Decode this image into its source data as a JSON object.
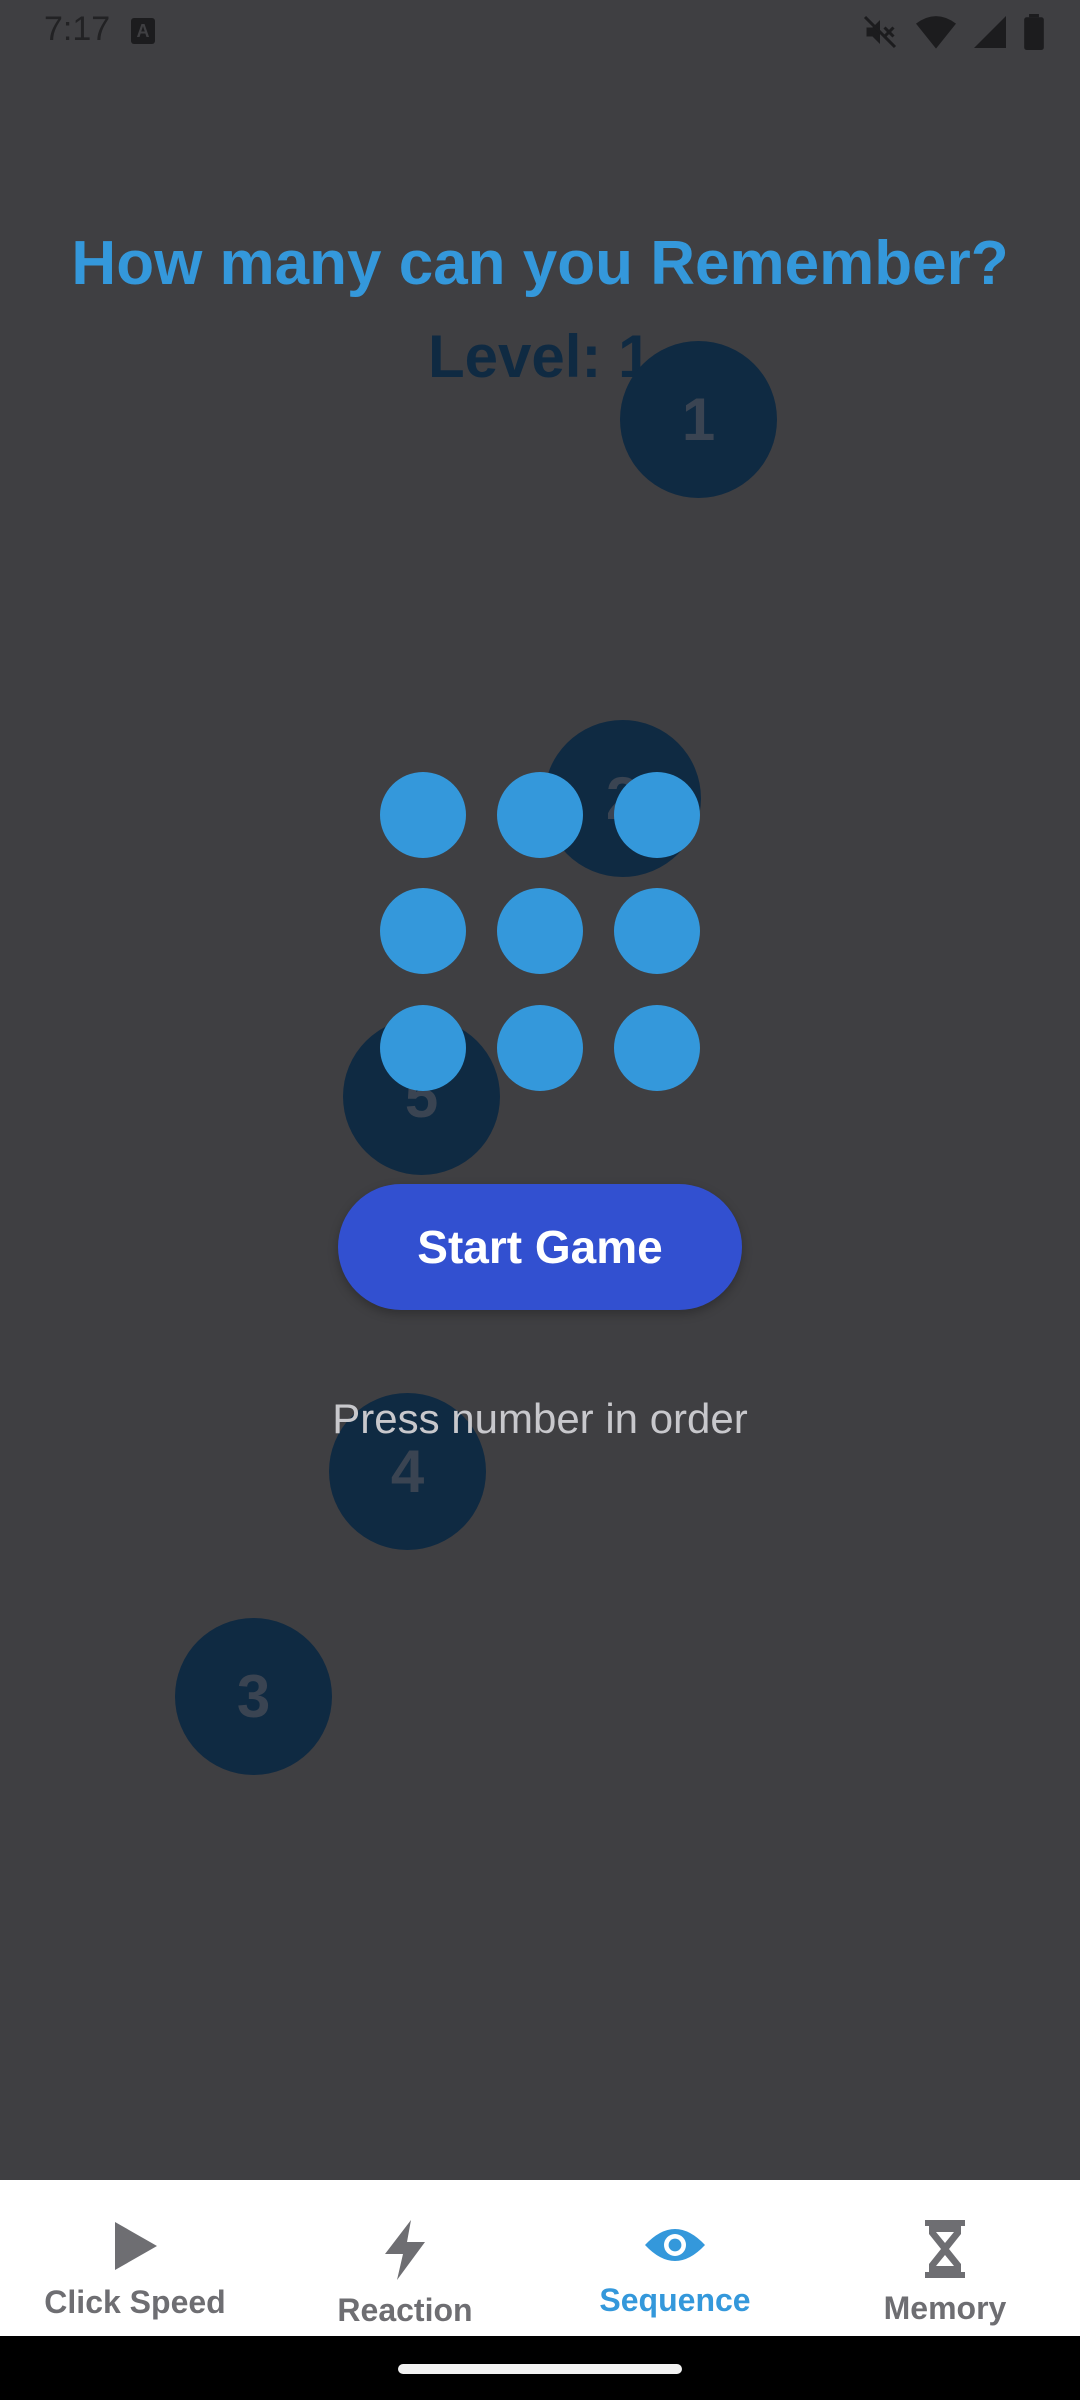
{
  "status_bar": {
    "time": "7:17",
    "icons": [
      "a-icon",
      "mute-icon",
      "wifi-icon",
      "signal-icon",
      "battery-icon"
    ]
  },
  "game": {
    "title": "How many can you Remember?",
    "level_text": "Level: 1",
    "sequence_numbers": [
      "1",
      "2",
      "5",
      "4",
      "3"
    ],
    "grid_rows": 3,
    "grid_cols": 3,
    "start_label": "Start Game",
    "hint": "Press number in order"
  },
  "nav": {
    "items": [
      {
        "label": "Click Speed",
        "icon": "play-icon",
        "active": false
      },
      {
        "label": "Reaction",
        "icon": "lightning-icon",
        "active": false
      },
      {
        "label": "Sequence",
        "icon": "eye-icon",
        "active": true
      },
      {
        "label": "Memory",
        "icon": "hourglass-icon",
        "active": false
      }
    ]
  },
  "colors": {
    "background": "#3f3f42",
    "accent": "#3498db",
    "button": "#3250d0",
    "sequence_circle": "#0f2a42"
  }
}
